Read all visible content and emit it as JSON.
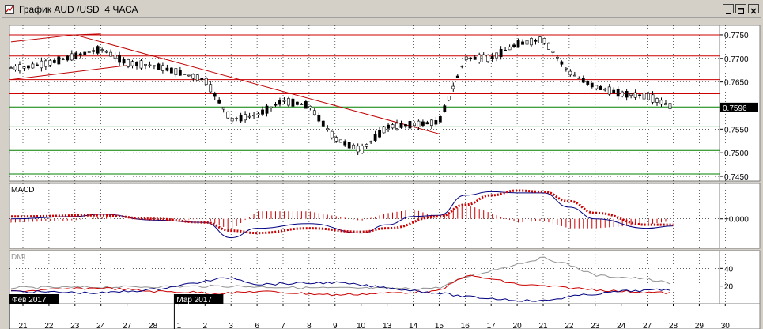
{
  "window": {
    "title": "График AUD /USD  4 ЧАСА",
    "buttons": [
      "minimize",
      "maximize",
      "close"
    ]
  },
  "chart_data": [
    {
      "type": "candlestick",
      "panel": "price",
      "title": "",
      "price_axis_ticks": [
        "0.7750",
        "0.7700",
        "0.7650",
        "0.7550",
        "0.7500",
        "0.7450"
      ],
      "last_price": "0.7596",
      "ylim": [
        0.744,
        0.777
      ],
      "horizontal_levels": {
        "red": [
          0.775,
          0.7705,
          0.7655,
          0.7625
        ],
        "green": [
          0.7597,
          0.7555,
          0.7505,
          0.7455
        ]
      },
      "trendlines": [
        {
          "color": "#c00000",
          "from": [
            "23",
            0.775
          ],
          "to": [
            "24",
            0.7752
          ]
        },
        {
          "color": "#c00000",
          "from": [
            "21",
            0.7735
          ],
          "to": [
            "23",
            0.775
          ]
        },
        {
          "color": "#c00000",
          "from": [
            "21",
            0.7655
          ],
          "to": [
            "27",
            0.7685
          ]
        },
        {
          "color": "#c00000",
          "from": [
            "23",
            0.775
          ],
          "to": [
            "15",
            0.754
          ]
        }
      ],
      "close_path": [
        [
          "21",
          0.768
        ],
        [
          "22",
          0.769
        ],
        [
          "23",
          0.7705
        ],
        [
          "24",
          0.772
        ],
        [
          "27",
          0.769
        ],
        [
          "28",
          0.7685
        ],
        [
          "1",
          0.767
        ],
        [
          "2",
          0.7655
        ],
        [
          "3",
          0.757
        ],
        [
          "6",
          0.758
        ],
        [
          "7",
          0.761
        ],
        [
          "8",
          0.76
        ],
        [
          "9",
          0.753
        ],
        [
          "10",
          0.7505
        ],
        [
          "13",
          0.7555
        ],
        [
          "14",
          0.756
        ],
        [
          "15",
          0.7565
        ],
        [
          "16",
          0.77
        ],
        [
          "17",
          0.77
        ],
        [
          "20",
          0.773
        ],
        [
          "21",
          0.774
        ],
        [
          "22",
          0.767
        ],
        [
          "23",
          0.764
        ],
        [
          "24",
          0.7625
        ],
        [
          "27",
          0.762
        ],
        [
          "28",
          0.7596
        ]
      ]
    },
    {
      "type": "line",
      "panel": "indicator",
      "title": "MACD",
      "tick_labels": [
        "+0.000"
      ],
      "series": [
        {
          "name": "MACD",
          "color": "#000080",
          "style": "line",
          "values": [
            [
              "21",
              0.0
            ],
            [
              "23",
              0.0002
            ],
            [
              "24",
              0.0004
            ],
            [
              "28",
              -0.0001
            ],
            [
              "2",
              -0.0003
            ],
            [
              "3",
              -0.0016
            ],
            [
              "6",
              -0.0008
            ],
            [
              "8",
              -0.0004
            ],
            [
              "10",
              -0.0012
            ],
            [
              "13",
              -0.0005
            ],
            [
              "14",
              0.0002
            ],
            [
              "15",
              0.0003
            ],
            [
              "16",
              0.002
            ],
            [
              "17",
              0.0023
            ],
            [
              "20",
              0.0022
            ],
            [
              "21",
              0.0022
            ],
            [
              "22",
              0.001
            ],
            [
              "23",
              0.0
            ],
            [
              "27",
              -0.0008
            ],
            [
              "28",
              -0.0006
            ]
          ]
        },
        {
          "name": "Signal",
          "color": "#cc0000",
          "style": "dotted",
          "values": [
            [
              "21",
              0.0002
            ],
            [
              "24",
              0.0003
            ],
            [
              "28",
              0.0
            ],
            [
              "2",
              -0.0003
            ],
            [
              "3",
              -0.001
            ],
            [
              "6",
              -0.0012
            ],
            [
              "8",
              -0.0008
            ],
            [
              "10",
              -0.0011
            ],
            [
              "13",
              -0.0008
            ],
            [
              "15",
              0.0002
            ],
            [
              "16",
              0.0012
            ],
            [
              "17",
              0.002
            ],
            [
              "20",
              0.0024
            ],
            [
              "21",
              0.0023
            ],
            [
              "22",
              0.0015
            ],
            [
              "23",
              0.0005
            ],
            [
              "27",
              -0.0005
            ],
            [
              "28",
              -0.0005
            ]
          ]
        }
      ],
      "histogram_color": "#cc0000"
    },
    {
      "type": "line",
      "panel": "indicator",
      "title": "DMI",
      "tick_labels": [
        "40",
        "20"
      ],
      "ylim": [
        0,
        60
      ],
      "series": [
        {
          "name": "ADX",
          "color": "#909090",
          "values": [
            [
              "21",
              18
            ],
            [
              "3",
              20
            ],
            [
              "8",
              18
            ],
            [
              "14",
              17
            ],
            [
              "15",
              18
            ],
            [
              "16",
              30
            ],
            [
              "20",
              45
            ],
            [
              "21",
              52
            ],
            [
              "22",
              44
            ],
            [
              "23",
              32
            ],
            [
              "27",
              28
            ],
            [
              "28",
              22
            ]
          ]
        },
        {
          "name": "+DI",
          "color": "#cc0000",
          "values": [
            [
              "21",
              14
            ],
            [
              "24",
              18
            ],
            [
              "28",
              14
            ],
            [
              "3",
              12
            ],
            [
              "6",
              14
            ],
            [
              "9",
              10
            ],
            [
              "13",
              12
            ],
            [
              "15",
              14
            ],
            [
              "16",
              32
            ],
            [
              "17",
              28
            ],
            [
              "20",
              22
            ],
            [
              "21",
              20
            ],
            [
              "22",
              18
            ],
            [
              "24",
              14
            ],
            [
              "28",
              12
            ]
          ]
        },
        {
          "name": "-DI",
          "color": "#000080",
          "values": [
            [
              "21",
              14
            ],
            [
              "24",
              12
            ],
            [
              "28",
              16
            ],
            [
              "3",
              30
            ],
            [
              "6",
              22
            ],
            [
              "9",
              24
            ],
            [
              "13",
              18
            ],
            [
              "15",
              12
            ],
            [
              "16",
              8
            ],
            [
              "17",
              6
            ],
            [
              "20",
              4
            ],
            [
              "21",
              3
            ],
            [
              "22",
              8
            ],
            [
              "24",
              14
            ],
            [
              "28",
              16
            ]
          ]
        }
      ]
    }
  ],
  "time_axis": {
    "labels": [
      "21",
      "22",
      "23",
      "24",
      "27",
      "28",
      "1",
      "2",
      "3",
      "6",
      "7",
      "8",
      "9",
      "10",
      "13",
      "14",
      "15",
      "16",
      "17",
      "20",
      "21",
      "22",
      "23",
      "24",
      "27",
      "28",
      "29",
      "30"
    ],
    "month_markers": [
      "Фев 2017",
      "Мар 2017"
    ]
  }
}
